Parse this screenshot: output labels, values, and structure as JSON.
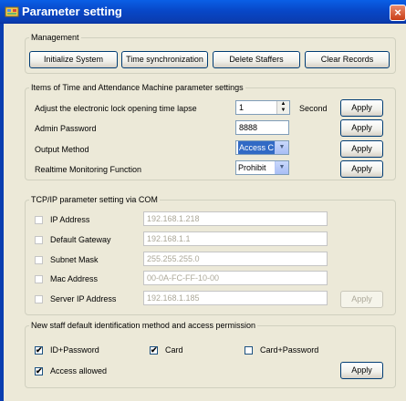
{
  "window": {
    "title": "Parameter setting",
    "close_glyph": "×"
  },
  "management": {
    "legend": "Management",
    "buttons": [
      "Initialize System",
      "Time synchronization",
      "Delete Staffers",
      "Clear Records"
    ]
  },
  "machine": {
    "legend": "Items of Time and Attendance Machine parameter settings",
    "lock_label": "Adjust the electronic lock opening time lapse",
    "lock_value": "1",
    "lock_unit": "Second",
    "admin_label": "Admin Password",
    "admin_value": "8888",
    "output_label": "Output Method",
    "output_value": "Access C",
    "realtime_label": "Realtime Monitoring Function",
    "realtime_value": "Prohibit",
    "apply_label": "Apply"
  },
  "tcpip": {
    "legend": "TCP/IP parameter setting via COM",
    "fields": [
      {
        "label": "IP Address",
        "value": "192.168.1.218",
        "checked": false
      },
      {
        "label": "Default Gateway",
        "value": "192.168.1.1",
        "checked": false
      },
      {
        "label": "Subnet Mask",
        "value": "255.255.255.0",
        "checked": false
      },
      {
        "label": "Mac Address",
        "value": "00-0A-FC-FF-10-00",
        "checked": false
      },
      {
        "label": "Server IP Address",
        "value": "192.168.1.185",
        "checked": false
      }
    ],
    "apply_label": "Apply"
  },
  "newstaff": {
    "legend": "New staff default identification method and access permission",
    "options": [
      {
        "label": "ID+Password",
        "checked": true
      },
      {
        "label": "Card",
        "checked": true
      },
      {
        "label": "Card+Password",
        "checked": false
      },
      {
        "label": "Access allowed",
        "checked": true
      }
    ],
    "apply_label": "Apply"
  },
  "icons": {
    "check_glyph": "✔",
    "dropdown": "chevron-down-icon",
    "spinner": "spinner-arrows-icon"
  },
  "colors": {
    "titlebar": "#0A5FE6",
    "window_bg": "#ECE9D8",
    "selection": "#316AC5",
    "close": "#C93E16"
  }
}
